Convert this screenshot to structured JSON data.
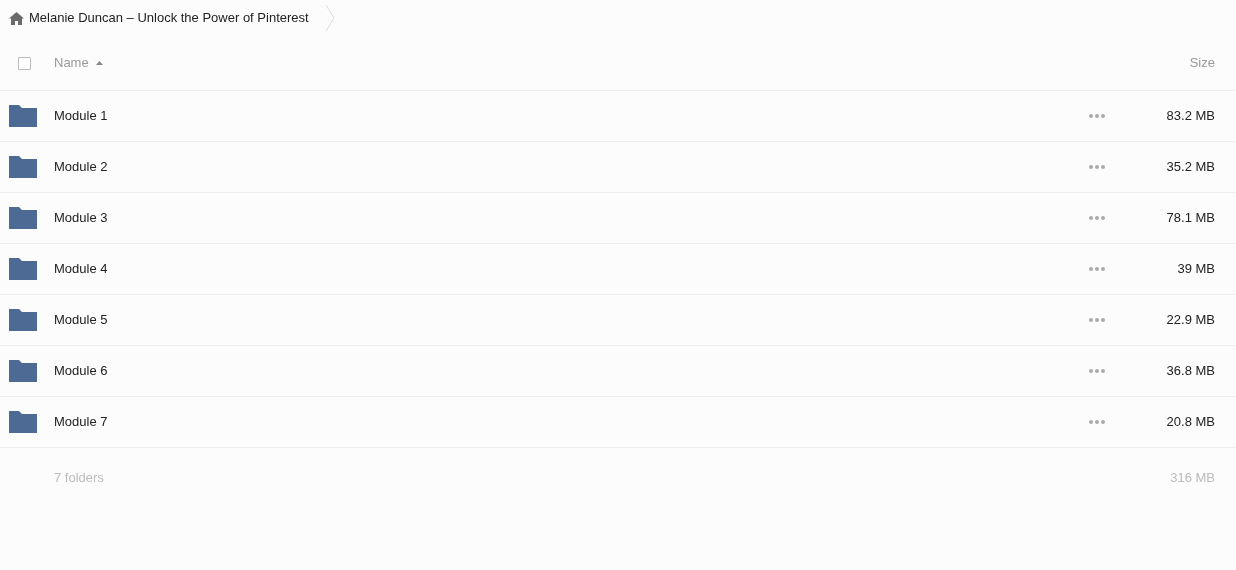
{
  "breadcrumb": {
    "title": "Melanie Duncan – Unlock the Power of Pinterest"
  },
  "header": {
    "select_all_checked": false,
    "name_label": "Name",
    "sort_ascending": true,
    "size_label": "Size"
  },
  "rows": [
    {
      "name": "Module 1",
      "size": "83.2 MB"
    },
    {
      "name": "Module 2",
      "size": "35.2 MB"
    },
    {
      "name": "Module 3",
      "size": "78.1 MB"
    },
    {
      "name": "Module 4",
      "size": "39 MB"
    },
    {
      "name": "Module 5",
      "size": "22.9 MB"
    },
    {
      "name": "Module 6",
      "size": "36.8 MB"
    },
    {
      "name": "Module 7",
      "size": "20.8 MB"
    }
  ],
  "footer": {
    "summary": "7 folders",
    "total": "316 MB"
  }
}
